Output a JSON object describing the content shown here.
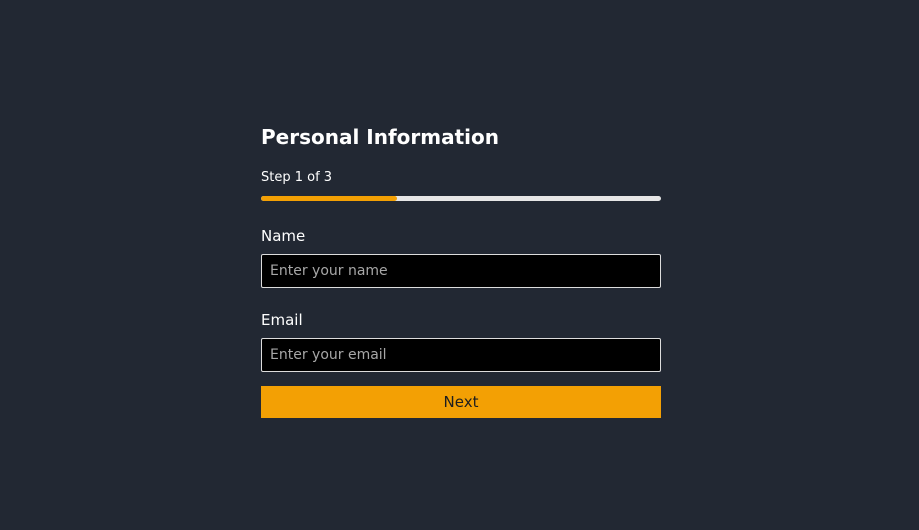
{
  "form": {
    "title": "Personal Information",
    "step_text": "Step 1 of 3",
    "progress": 0.34,
    "fields": {
      "name": {
        "label": "Name",
        "value": "",
        "placeholder": "Enter your name"
      },
      "email": {
        "label": "Email",
        "value": "",
        "placeholder": "Enter your email"
      }
    },
    "next_label": "Next"
  },
  "colors": {
    "background": "#222833",
    "accent": "#f3a004",
    "progress_track": "#e6e6e6",
    "input_background": "#000000",
    "input_border": "#dddddd"
  }
}
